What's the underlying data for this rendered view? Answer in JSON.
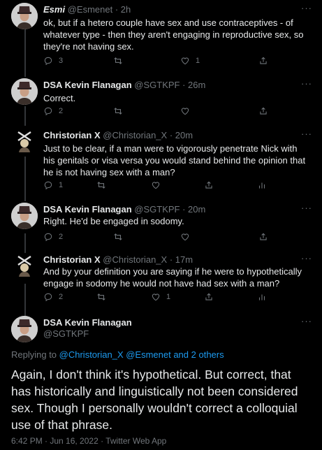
{
  "tweets": [
    {
      "name": "Esmi",
      "handle": "@Esmenet",
      "time": "· 2h",
      "text": "ok, but if a hetero couple have sex and use contraceptives - of whatever type - then they aren't engaging in reproductive sex, so they're not having sex.",
      "replies": "3",
      "retweets": "",
      "likes": "1"
    },
    {
      "name": "DSA Kevin Flanagan",
      "handle": "@SGTKPF",
      "time": "· 26m",
      "text": "Correct.",
      "replies": "2",
      "retweets": "",
      "likes": ""
    },
    {
      "name": "Christorian X",
      "handle": "@Christorian_X",
      "time": "· 20m",
      "text": "Just to be clear, if a man were to vigorously penetrate Nick with his genitals or visa versa you would stand behind the opinion that he is not having sex with a man?",
      "replies": "1",
      "retweets": "",
      "likes": ""
    },
    {
      "name": "DSA Kevin Flanagan",
      "handle": "@SGTKPF",
      "time": "· 20m",
      "text": "Right. He'd be engaged in sodomy.",
      "replies": "2",
      "retweets": "",
      "likes": ""
    },
    {
      "name": "Christorian X",
      "handle": "@Christorian_X",
      "time": "· 17m",
      "text": "And by your definition you are saying if he were to hypothetically engage in sodomy he would not have had sex with a man?",
      "replies": "2",
      "retweets": "",
      "likes": "1"
    }
  ],
  "main": {
    "name": "DSA Kevin Flanagan",
    "handle": "@SGTKPF",
    "replying_prefix": "Replying to ",
    "replying_to": "@Christorian_X @Esmenet and 2 others",
    "text": "Again, I don't think it's hypothetical. But correct, that has historically and linguistically not been considered sex. Though I personally wouldn't correct a colloquial use of that phrase.",
    "meta": "6:42 PM · Jun 16, 2022 · Twitter Web App"
  },
  "icons": {
    "more": "more-dots-icon",
    "reply": "reply-bubble-icon",
    "retweet": "retweet-icon",
    "like": "heart-icon",
    "share": "share-icon",
    "analytics": "analytics-icon"
  },
  "colors": {
    "background": "#000000",
    "text": "#e7e9ea",
    "muted": "#71767b",
    "link": "#1d9bf0"
  }
}
